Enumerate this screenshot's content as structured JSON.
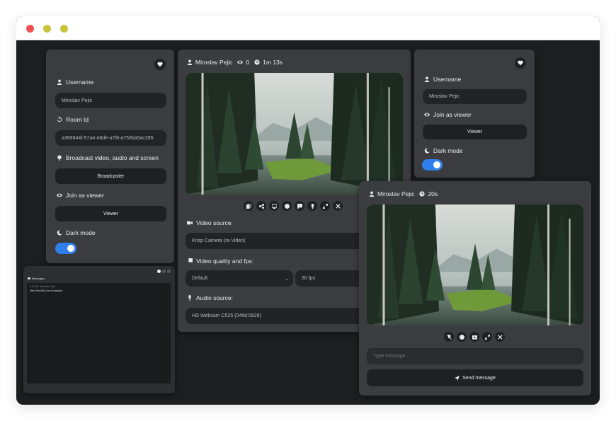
{
  "left_panel": {
    "username_label": "Username",
    "username_value": "Miroslav Pejic",
    "room_label": "Room Id",
    "room_value": "a369844f-57a4-48de-a7f8-a753ba5ac285",
    "broadcast_label": "Broadcast video, audio and screen",
    "broadcaster_button": "Broadcaster",
    "join_label": "Join as viewer",
    "viewer_button": "Viewer",
    "dark_mode_label": "Dark mode",
    "dark_mode_on": true
  },
  "center_panel": {
    "name": "Miroslav Pejic",
    "viewers": "0",
    "duration": "1m 13s",
    "video_source_label": "Video source:",
    "video_source_value": "Krisp Camera (ra Video)",
    "quality_label": "Video quality and fps:",
    "quality_value": "Default",
    "fps_value": "30 fps",
    "audio_source_label": "Audio source:",
    "audio_source_value": "HD Webcam C525 (046d:0826)"
  },
  "right_top_panel": {
    "username_label": "Username",
    "username_value": "Miroslav Pejic",
    "join_label": "Join as viewer",
    "viewer_button": "Viewer",
    "dark_mode_label": "Dark mode",
    "dark_mode_on": true
  },
  "right_bottom_panel": {
    "name": "Miroslav Pejic",
    "duration": "20s",
    "message_placeholder": "Type message...",
    "send_button": "Send message"
  },
  "messages_panel": {
    "title": "Messages",
    "meta": "0:11:28 - Miroslav Pejic",
    "text": "Hello MiroTalk Live Broadcast"
  },
  "colors": {
    "accent": "#2f80ed",
    "panel": "#3a3c3f",
    "field": "#222326",
    "background": "#1d1e20"
  }
}
